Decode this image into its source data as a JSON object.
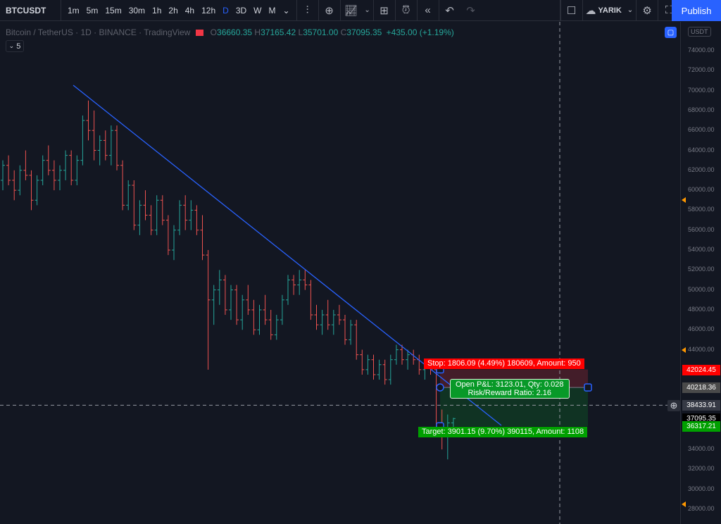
{
  "toolbar": {
    "symbol": "BTCUSDT",
    "timeframes": [
      "1m",
      "5m",
      "15m",
      "30m",
      "1h",
      "2h",
      "4h",
      "12h",
      "D",
      "3D",
      "W",
      "M"
    ],
    "active_timeframe": "D",
    "layout_name": "YARIK",
    "publish_label": "Publish",
    "icons": [
      "chevron-down-icon",
      "bar-style-icon",
      "add-indicator-icon",
      "indicators-icon",
      "chevron-down-icon",
      "layout-grid-icon",
      "alert-icon",
      "replay-icon",
      "undo-icon",
      "redo-icon",
      "square-icon",
      "cloud-check-icon",
      "gear-icon",
      "fullscreen-icon",
      "camera-icon"
    ]
  },
  "legend": {
    "title": "Bitcoin / TetherUS · 1D · BINANCE · TradingView",
    "o_label": "O",
    "o": "36660.35",
    "h_label": "H",
    "h": "37165.42",
    "l_label": "L",
    "l": "35701.00",
    "c_label": "C",
    "c": "37095.35",
    "change": "+435.00 (+1.19%)",
    "indicators_count": "5"
  },
  "axis": {
    "currency": "USDT",
    "ticks": [
      "74000.00",
      "72000.00",
      "70000.00",
      "68000.00",
      "66000.00",
      "64000.00",
      "62000.00",
      "60000.00",
      "58000.00",
      "56000.00",
      "54000.00",
      "52000.00",
      "50000.00",
      "48000.00",
      "46000.00",
      "44000.00",
      "42000.00",
      "40000.00",
      "38000.00",
      "36000.00",
      "34000.00",
      "32000.00",
      "30000.00",
      "28000.00"
    ],
    "labels": [
      {
        "text": "42024.45",
        "price": 42024.45,
        "bg": "#ff0000"
      },
      {
        "text": "40218.36",
        "price": 40218.36,
        "bg": "#4a4a4a"
      },
      {
        "text": "38433.91",
        "price": 38433.91,
        "bg": "#363a45"
      },
      {
        "text": "37095.35",
        "price": 37095.35,
        "bg": "#000000"
      },
      {
        "text": "36317.21",
        "price": 36317.21,
        "bg": "#00a000"
      }
    ],
    "alert_prices": [
      59000,
      44000,
      28500
    ]
  },
  "position": {
    "stop_text": "Stop: 1806.09 (4.49%) 180609, Amount: 950",
    "pnl_text": "Open P&L: 3123.01, Qty: 0.028",
    "rr_text": "Risk/Reward Ratio: 2.16",
    "target_text": "Target: 3901.15 (9.70%) 390115, Amount: 1108",
    "stop_price": 42024.45,
    "entry_price": 40218.36,
    "target_price": 36317.21
  },
  "crosshair_price": 38433.91,
  "colors": {
    "up": "#26a69a",
    "down": "#ef5350",
    "trendline": "#2962ff",
    "accent": "#2962ff",
    "stop": "#ff0000",
    "target": "#00a000"
  },
  "chart_data": {
    "type": "ohlc",
    "ylim": [
      27000,
      75500
    ],
    "trendline": [
      [
        69900,
        "start"
      ],
      [
        36000,
        "end"
      ]
    ],
    "bars": [
      [
        61000,
        63000,
        60000,
        62500
      ],
      [
        62500,
        63500,
        60500,
        61000
      ],
      [
        61000,
        62000,
        59000,
        60000
      ],
      [
        60000,
        62500,
        59500,
        62000
      ],
      [
        62000,
        64000,
        61000,
        61500
      ],
      [
        61500,
        62000,
        58000,
        59000
      ],
      [
        59000,
        61500,
        58500,
        61000
      ],
      [
        61000,
        63500,
        60500,
        63000
      ],
      [
        63000,
        64500,
        61500,
        62000
      ],
      [
        62000,
        63000,
        60000,
        61000
      ],
      [
        61000,
        62500,
        60000,
        62000
      ],
      [
        62000,
        64000,
        61000,
        63500
      ],
      [
        63500,
        64000,
        60500,
        61000
      ],
      [
        61000,
        63500,
        60500,
        63000
      ],
      [
        63000,
        67500,
        62500,
        67000
      ],
      [
        67000,
        69000,
        65000,
        66000
      ],
      [
        66000,
        68000,
        63000,
        64000
      ],
      [
        64000,
        65500,
        62500,
        65000
      ],
      [
        65000,
        66000,
        63000,
        63500
      ],
      [
        63500,
        66500,
        62500,
        66000
      ],
      [
        66000,
        66500,
        62000,
        62500
      ],
      [
        62500,
        63000,
        58000,
        58500
      ],
      [
        58500,
        61000,
        58000,
        60500
      ],
      [
        60500,
        61000,
        56000,
        56500
      ],
      [
        56500,
        59000,
        55500,
        58500
      ],
      [
        58500,
        60000,
        57000,
        57500
      ],
      [
        57500,
        58500,
        55500,
        56000
      ],
      [
        56000,
        59500,
        55500,
        59000
      ],
      [
        59000,
        59500,
        56500,
        57000
      ],
      [
        57000,
        57500,
        53500,
        54000
      ],
      [
        54000,
        56500,
        53000,
        56000
      ],
      [
        56000,
        59000,
        55500,
        58500
      ],
      [
        58500,
        59500,
        56000,
        57000
      ],
      [
        57000,
        59000,
        56000,
        58000
      ],
      [
        58000,
        58500,
        55500,
        56000
      ],
      [
        56000,
        57500,
        53000,
        53500
      ],
      [
        53500,
        54000,
        42000,
        49000
      ],
      [
        49000,
        50500,
        46500,
        50000
      ],
      [
        50000,
        52000,
        48500,
        51000
      ],
      [
        51000,
        51500,
        47500,
        48000
      ],
      [
        48000,
        50500,
        47000,
        50000
      ],
      [
        50000,
        50500,
        46500,
        47000
      ],
      [
        47000,
        49500,
        46000,
        49000
      ],
      [
        49000,
        50500,
        47500,
        48000
      ],
      [
        48000,
        49000,
        45500,
        46000
      ],
      [
        46000,
        48500,
        45500,
        48000
      ],
      [
        48000,
        49500,
        46500,
        47000
      ],
      [
        47000,
        48000,
        45000,
        45500
      ],
      [
        45500,
        47500,
        45000,
        47000
      ],
      [
        47000,
        49500,
        46500,
        49000
      ],
      [
        49000,
        51500,
        48500,
        51000
      ],
      [
        51000,
        51500,
        49500,
        50500
      ],
      [
        50500,
        52000,
        49500,
        51000
      ],
      [
        51000,
        52000,
        50000,
        50500
      ],
      [
        50500,
        51000,
        47000,
        47500
      ],
      [
        47500,
        48500,
        46000,
        46500
      ],
      [
        46500,
        48000,
        45500,
        47500
      ],
      [
        47500,
        49000,
        46000,
        46500
      ],
      [
        46500,
        48000,
        45500,
        47500
      ],
      [
        47500,
        48500,
        46500,
        47000
      ],
      [
        47000,
        47500,
        44500,
        45000
      ],
      [
        45000,
        47000,
        44500,
        46500
      ],
      [
        46500,
        47000,
        43000,
        43500
      ],
      [
        43500,
        44000,
        41500,
        42000
      ],
      [
        42000,
        43500,
        41500,
        43000
      ],
      [
        43000,
        43500,
        41000,
        41500
      ],
      [
        41500,
        43000,
        41000,
        42500
      ],
      [
        42500,
        43000,
        40500,
        41000
      ],
      [
        41000,
        43500,
        40500,
        43000
      ],
      [
        43000,
        44500,
        42500,
        44000
      ],
      [
        44000,
        44500,
        42500,
        43000
      ],
      [
        43000,
        44000,
        42000,
        43500
      ],
      [
        43500,
        44000,
        42500,
        43000
      ],
      [
        43000,
        43500,
        41500,
        42000
      ],
      [
        42000,
        43000,
        41000,
        42500
      ],
      [
        42500,
        43000,
        41500,
        42000
      ],
      [
        42000,
        42500,
        35500,
        36500
      ],
      [
        36500,
        38000,
        34000,
        35500
      ],
      [
        35500,
        37500,
        33000,
        36660.35
      ],
      [
        36660.35,
        37165.42,
        35701.0,
        37095.35
      ]
    ]
  }
}
